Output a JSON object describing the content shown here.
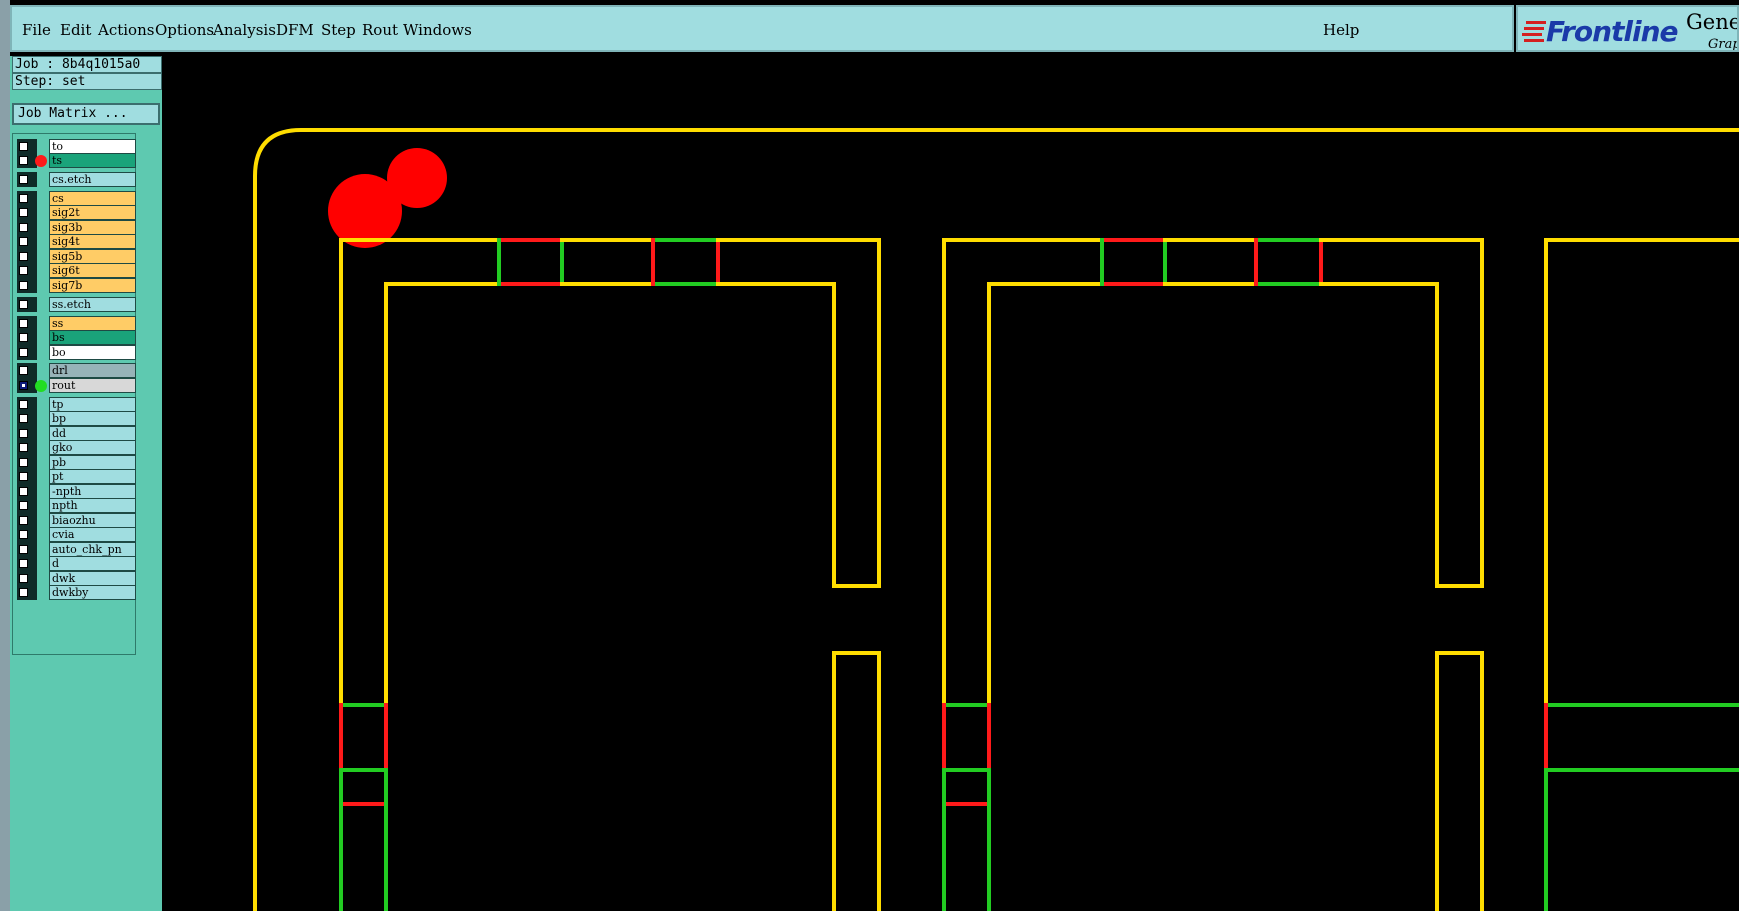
{
  "menubar": {
    "items": [
      "File",
      "Edit",
      "Actions",
      "Options",
      "Analysis",
      "DFM",
      "Step",
      "Rout",
      "Windows"
    ],
    "help": "Help"
  },
  "logo": {
    "brand": "Frontline",
    "product": "Gene",
    "product_sub": "Grap"
  },
  "job_info": {
    "job": "Job : 8b4q1015a0",
    "step": "Step: set",
    "job_matrix": "Job Matrix ..."
  },
  "layers": [
    {
      "name": "to",
      "color": "#ffffff",
      "dot": null
    },
    {
      "name": "ts",
      "color": "#1aa37a",
      "dot": "#ff1a1a"
    },
    {
      "name": "cs.etch",
      "color": "#a0dde0",
      "dot": null
    },
    {
      "name": "cs",
      "color": "#ffcc66",
      "dot": null
    },
    {
      "name": "sig2t",
      "color": "#ffcc66",
      "dot": null
    },
    {
      "name": "sig3b",
      "color": "#ffcc66",
      "dot": null
    },
    {
      "name": "sig4t",
      "color": "#ffcc66",
      "dot": null
    },
    {
      "name": "sig5b",
      "color": "#ffcc66",
      "dot": null
    },
    {
      "name": "sig6t",
      "color": "#ffcc66",
      "dot": null
    },
    {
      "name": "sig7b",
      "color": "#ffcc66",
      "dot": null
    },
    {
      "name": "ss.etch",
      "color": "#a0dde0",
      "dot": null
    },
    {
      "name": "ss",
      "color": "#ffcc66",
      "dot": null
    },
    {
      "name": "bs",
      "color": "#1aa37a",
      "dot": null
    },
    {
      "name": "bo",
      "color": "#ffffff",
      "dot": null
    },
    {
      "name": "drl",
      "color": "#97b3b8",
      "dot": null
    },
    {
      "name": "rout",
      "color": "#d8d8d8",
      "dot": "#22dd22",
      "active": true
    },
    {
      "name": "tp",
      "color": "#a0dde0",
      "dot": null
    },
    {
      "name": "bp",
      "color": "#a0dde0",
      "dot": null
    },
    {
      "name": "dd",
      "color": "#a0dde0",
      "dot": null
    },
    {
      "name": "gko",
      "color": "#a0dde0",
      "dot": null
    },
    {
      "name": "pb",
      "color": "#a0dde0",
      "dot": null
    },
    {
      "name": "pt",
      "color": "#a0dde0",
      "dot": null
    },
    {
      "name": "-npth",
      "color": "#a0dde0",
      "dot": null
    },
    {
      "name": "npth",
      "color": "#a0dde0",
      "dot": null
    },
    {
      "name": "biaozhu",
      "color": "#a0dde0",
      "dot": null
    },
    {
      "name": "cvia",
      "color": "#a0dde0",
      "dot": null
    },
    {
      "name": "auto_chk_pn",
      "color": "#a0dde0",
      "dot": null
    },
    {
      "name": "d",
      "color": "#a0dde0",
      "dot": null
    },
    {
      "name": "dwk",
      "color": "#a0dde0",
      "dot": null
    },
    {
      "name": "dwkby",
      "color": "#a0dde0",
      "dot": null
    }
  ],
  "colors": {
    "outline": "#ffdd00",
    "tab_red": "#ff1a1a",
    "tab_green": "#22cc22",
    "pad_red": "#ff0000"
  }
}
